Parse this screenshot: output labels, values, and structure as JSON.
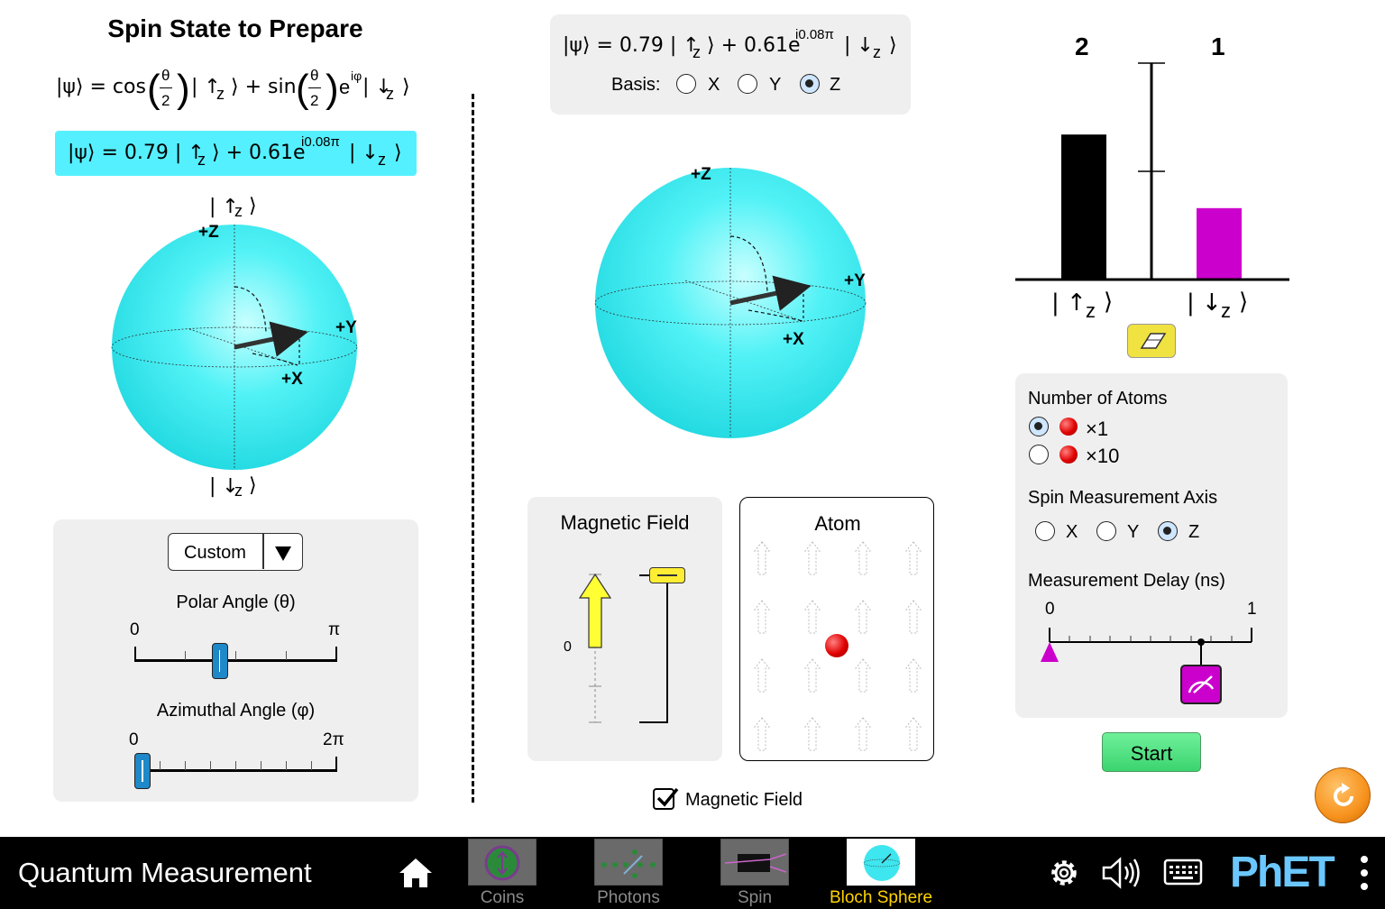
{
  "left": {
    "title": "Spin State to Prepare",
    "general_state": {
      "psi": "|ψ⟩ = cos",
      "theta": "θ",
      "two": "2",
      "up": "| ↑",
      "z": "z",
      "close": "⟩ + sin",
      "exp": "e",
      "iphi": "iφ",
      "down": "| ↓",
      "z2": "z",
      "end": "⟩"
    },
    "state_box": {
      "psi": "|ψ⟩ = 0.79 | ↑",
      "z": "z",
      "mid": "⟩ + 0.61e",
      "exp": "i0.08π",
      "down": " | ↓",
      "z2": "z",
      "end": "⟩",
      "color": "#55f0ff"
    },
    "sphere_labels": {
      "up_ket": "| ↑",
      "up_z": "z",
      "up_end": "⟩",
      "plus_z": "+Z",
      "plus_y": "+Y",
      "plus_x": "+X",
      "down_ket": "| ↓",
      "down_z": "z",
      "down_end": "⟩"
    },
    "controls": {
      "preset": "Custom",
      "polar_label": "Polar Angle (θ)",
      "polar_min": "0",
      "polar_max": "π",
      "polar_value": 0.42,
      "azimuthal_label": "Azimuthal Angle (φ)",
      "azimuthal_min": "0",
      "azimuthal_max": "2π",
      "azimuthal_value": 0.04
    }
  },
  "center": {
    "state_box": {
      "psi": "|ψ⟩ = 0.79 | ↑",
      "z": "z",
      "mid": "⟩ + 0.61e",
      "exp": "i0.08π",
      "down": " | ↓",
      "z2": "z",
      "end": "⟩"
    },
    "basis_label": "Basis:",
    "basis_options": [
      "X",
      "Y",
      "Z"
    ],
    "basis_selected": "Z",
    "sphere_labels": {
      "plus_z": "+Z",
      "plus_y": "+Y",
      "plus_x": "+X"
    },
    "magnetic_field_title": "Magnetic Field",
    "field_zero": "0",
    "atom_title": "Atom",
    "magnetic_field_checkbox": "Magnetic Field",
    "magnetic_field_checked": true
  },
  "right": {
    "counts": [
      "2",
      "1"
    ],
    "bar_fractions": [
      0.67,
      0.33
    ],
    "bar_colors": [
      "#000000",
      "#cc00cc"
    ],
    "bar_labels": [
      {
        "ket": "| ↑",
        "z": "z",
        "end": "⟩"
      },
      {
        "ket": "| ↓",
        "z": "z",
        "end": "⟩"
      }
    ],
    "atoms_title": "Number of Atoms",
    "atoms_options": [
      "×1",
      "×10"
    ],
    "atoms_selected": "×1",
    "axis_title": "Spin Measurement Axis",
    "axis_options": [
      "X",
      "Y",
      "Z"
    ],
    "axis_selected": "Z",
    "delay_title": "Measurement Delay (ns)",
    "delay_min": "0",
    "delay_max": "1",
    "start_label": "Start"
  },
  "navbar": {
    "title": "Quantum Measurement",
    "screens": [
      "Coins",
      "Photons",
      "Spin",
      "Bloch Sphere"
    ],
    "active_screen": "Bloch Sphere",
    "brand": "PhET"
  }
}
